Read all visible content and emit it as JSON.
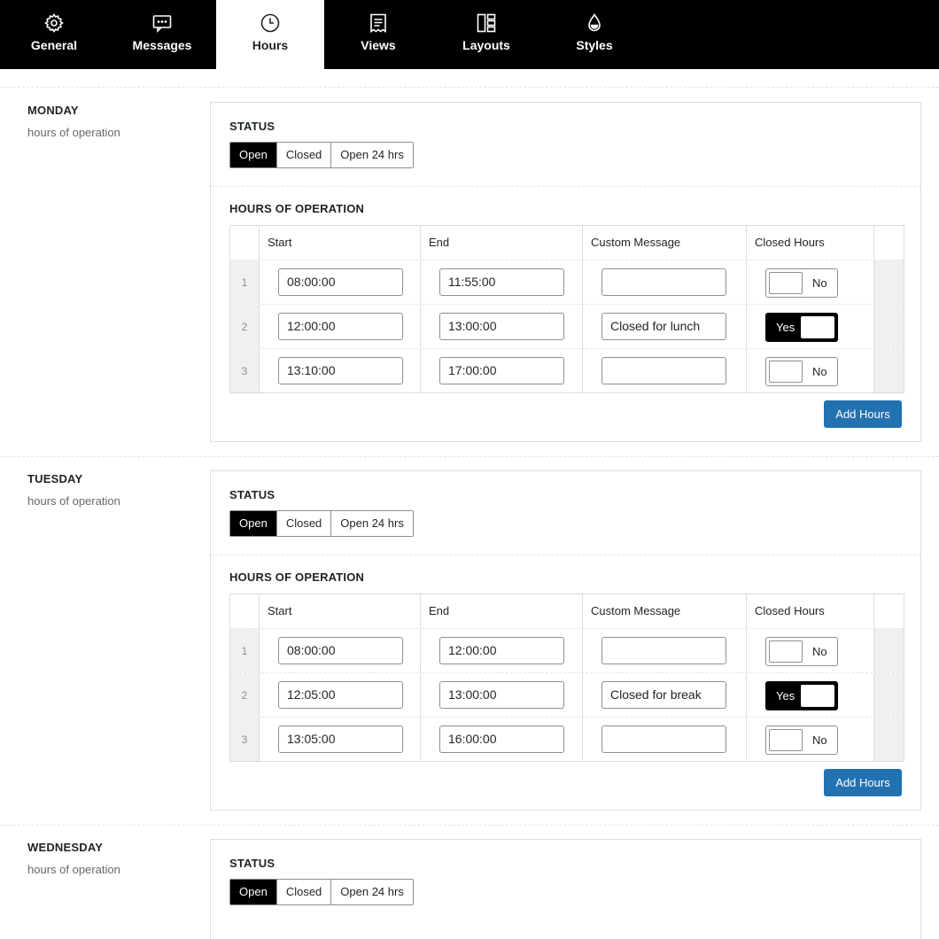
{
  "tabs": [
    {
      "label": "General",
      "icon": "gear-icon"
    },
    {
      "label": "Messages",
      "icon": "message-icon"
    },
    {
      "label": "Hours",
      "icon": "clock-icon"
    },
    {
      "label": "Views",
      "icon": "receipt-icon"
    },
    {
      "label": "Layouts",
      "icon": "layout-icon"
    },
    {
      "label": "Styles",
      "icon": "droplet-icon"
    }
  ],
  "active_tab": "Hours",
  "status_label": "STATUS",
  "hours_label": "HOURS OF OPERATION",
  "status_options": [
    "Open",
    "Closed",
    "Open 24 hrs"
  ],
  "columns": {
    "start": "Start",
    "end": "End",
    "message": "Custom Message",
    "closed": "Closed Hours"
  },
  "toggle": {
    "yes": "Yes",
    "no": "No"
  },
  "add_hours_label": "Add Hours",
  "accent_color": "#2271b1",
  "days": [
    {
      "name": "MONDAY",
      "subtitle": "hours of operation",
      "status": "Open",
      "rows": [
        {
          "num": "1",
          "start": "08:00:00",
          "end": "11:55:00",
          "message": "",
          "closed": false
        },
        {
          "num": "2",
          "start": "12:00:00",
          "end": "13:00:00",
          "message": "Closed for lunch",
          "closed": true
        },
        {
          "num": "3",
          "start": "13:10:00",
          "end": "17:00:00",
          "message": "",
          "closed": false
        }
      ]
    },
    {
      "name": "TUESDAY",
      "subtitle": "hours of operation",
      "status": "Open",
      "rows": [
        {
          "num": "1",
          "start": "08:00:00",
          "end": "12:00:00",
          "message": "",
          "closed": false
        },
        {
          "num": "2",
          "start": "12:05:00",
          "end": "13:00:00",
          "message": "Closed for break",
          "closed": true
        },
        {
          "num": "3",
          "start": "13:05:00",
          "end": "16:00:00",
          "message": "",
          "closed": false
        }
      ]
    },
    {
      "name": "WEDNESDAY",
      "subtitle": "hours of operation",
      "status": "Open",
      "rows": []
    }
  ]
}
